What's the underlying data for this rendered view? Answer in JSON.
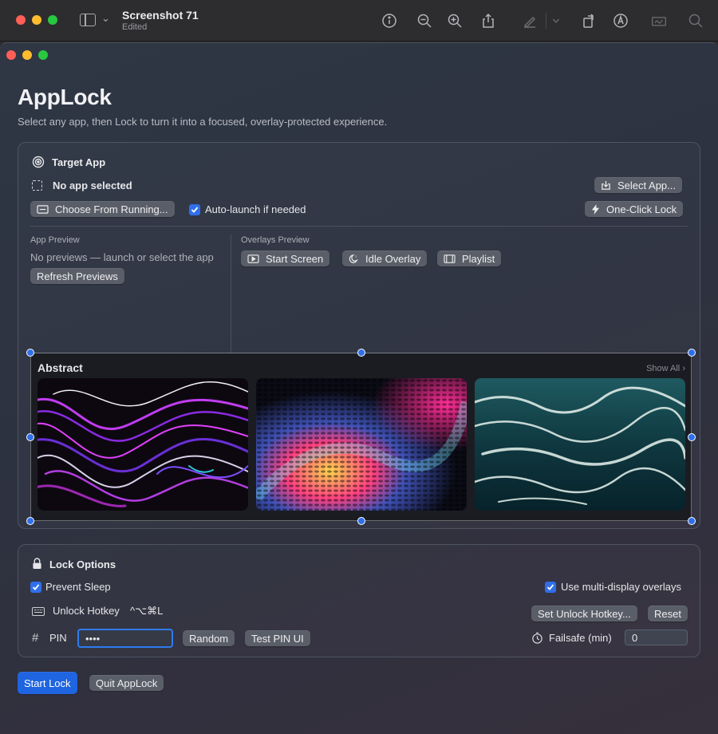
{
  "preview": {
    "title": "Screenshot 71",
    "subtitle": "Edited"
  },
  "app": {
    "title": "AppLock",
    "subtitle": "Select any app, then Lock to turn it into a focused, overlay-protected experience."
  },
  "target": {
    "heading": "Target App",
    "selected": "No app selected",
    "select_app": "Select App...",
    "choose_running": "Choose From Running...",
    "auto_launch": "Auto-launch if needed",
    "one_click": "One-Click Lock",
    "app_preview_label": "App Preview",
    "no_previews": "No previews — launch or select the app",
    "refresh": "Refresh Previews",
    "overlays_label": "Overlays Preview",
    "overlay_tabs": [
      "Start Screen",
      "Idle Overlay",
      "Playlist"
    ]
  },
  "gallery": {
    "title": "Abstract",
    "show_all": "Show All"
  },
  "lock": {
    "heading": "Lock Options",
    "prevent_sleep": "Prevent Sleep",
    "multi_display": "Use multi-display overlays",
    "unlock_hotkey_label": "Unlock Hotkey",
    "unlock_hotkey_value": "^⌥⌘L",
    "set_hotkey": "Set Unlock Hotkey...",
    "reset": "Reset",
    "pin_label": "PIN",
    "pin_value": "••••",
    "random": "Random",
    "test_pin": "Test PIN UI",
    "failsafe_label": "Failsafe (min)",
    "failsafe_value": "0"
  },
  "footer": {
    "start_lock": "Start Lock",
    "quit": "Quit AppLock"
  }
}
